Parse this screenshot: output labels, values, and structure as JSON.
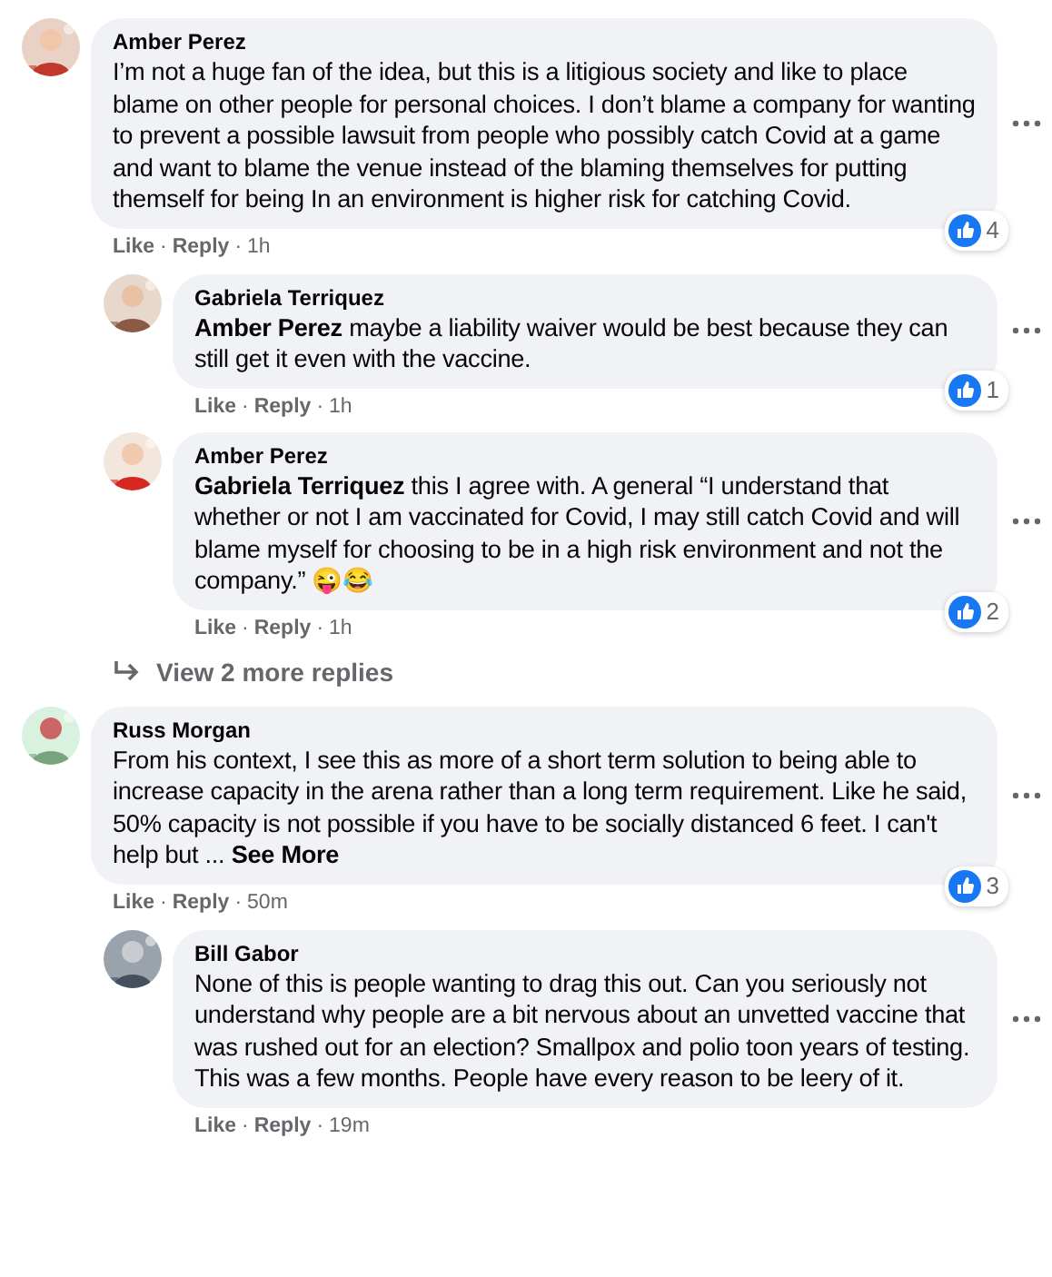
{
  "comments": [
    {
      "author": "Amber Perez",
      "text": "I’m not a huge fan of the idea, but this is a litigious society and like to place blame on other people for personal choices. I don’t blame a company for wanting to prevent a possible lawsuit from people who possibly catch Covid at a game and want to blame the venue instead of the blaming themselves for putting themself for being In an environment is higher risk for catching Covid.",
      "like_label": "Like",
      "separator": "·",
      "reply_label": "Reply",
      "time": "1h",
      "reactions": "4",
      "avatar": {
        "kind": "picture"
      },
      "children": [
        {
          "author": "Gabriela Terriquez",
          "text": "**Amber Perez** maybe a liability waiver would be best because they can still get it even with the vaccine.",
          "like_label": "Like",
          "separator": "·",
          "reply_label": "Reply",
          "time": "1h",
          "reactions": "1",
          "avatar": {
            "kind": "picture"
          }
        },
        {
          "author": "Amber Perez",
          "text": "**Gabriela Terriquez** this I agree with. A general “I understand that whether or not I am vaccinated for Covid, I may still catch Covid and will blame myself for choosing to be in a high risk environment and not the company.” 😜😂",
          "like_label": "Like",
          "separator": "·",
          "reply_label": "Reply",
          "time": "1h",
          "reactions": "2",
          "avatar": {
            "kind": "picture"
          }
        }
      ],
      "more_replies": "View 2 more replies"
    },
    {
      "author": "Russ Morgan",
      "text": "From his context, I see this as more of a short term solution to being able to increase capacity in the arena rather than a long term requirement. Like he said, 50% capacity is not possible if you have to be socially distanced 6 feet. I can't help but ...",
      "see_more": "See More",
      "like_label": "Like",
      "separator": "·",
      "reply_label": "Reply",
      "time": "50m",
      "reactions": "3",
      "avatar": {
        "kind": "picture"
      },
      "children": [
        {
          "author": "Bill Gabor",
          "text": "None of this is people wanting to drag this out. Can you seriously not understand why people are a bit nervous about an unvetted vaccine that was rushed out for an election? Smallpox and polio toon years of testing. This was a few months. People have every reason to be leery of it.",
          "like_label": "Like",
          "separator": "·",
          "reply_label": "Reply",
          "time": "19m",
          "avatar": {
            "kind": "picture"
          }
        }
      ]
    }
  ]
}
